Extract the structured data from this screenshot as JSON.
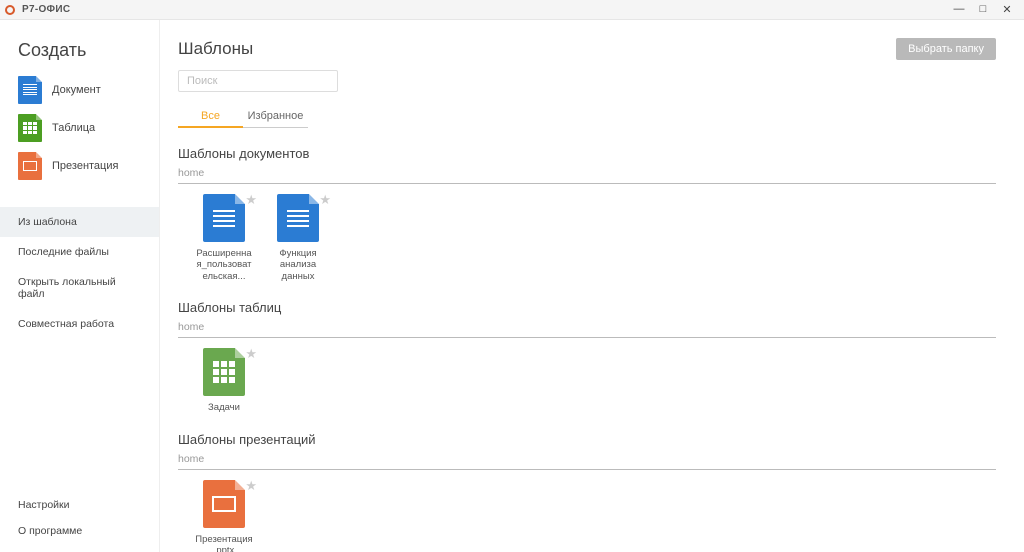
{
  "titlebar": {
    "app_name": "Р7-ОФИС"
  },
  "sidebar": {
    "create_heading": "Создать",
    "create_items": [
      {
        "label": "Документ",
        "type": "doc"
      },
      {
        "label": "Таблица",
        "type": "sheet"
      },
      {
        "label": "Презентация",
        "type": "pres"
      }
    ],
    "nav_items": [
      {
        "label": "Из шаблона",
        "active": true
      },
      {
        "label": "Последние файлы",
        "active": false
      },
      {
        "label": "Открыть локальный файл",
        "active": false
      },
      {
        "label": "Совместная работа",
        "active": false
      }
    ],
    "bottom_items": [
      {
        "label": "Настройки"
      },
      {
        "label": "О программе"
      }
    ]
  },
  "main": {
    "title": "Шаблоны",
    "choose_folder_btn": "Выбрать папку",
    "search_placeholder": "Поиск",
    "tabs": [
      {
        "label": "Все",
        "active": true
      },
      {
        "label": "Избранное",
        "active": false
      }
    ],
    "sections": [
      {
        "title": "Шаблоны документов",
        "path": "home",
        "type": "doc",
        "templates": [
          {
            "name": "Расширенная_пользовательская..."
          },
          {
            "name": "Функция анализа данных"
          }
        ]
      },
      {
        "title": "Шаблоны таблиц",
        "path": "home",
        "type": "sheet",
        "templates": [
          {
            "name": "Задачи"
          }
        ]
      },
      {
        "title": "Шаблоны презентаций",
        "path": "home",
        "type": "pres",
        "templates": [
          {
            "name": "Презентация.pptx"
          }
        ]
      }
    ]
  }
}
